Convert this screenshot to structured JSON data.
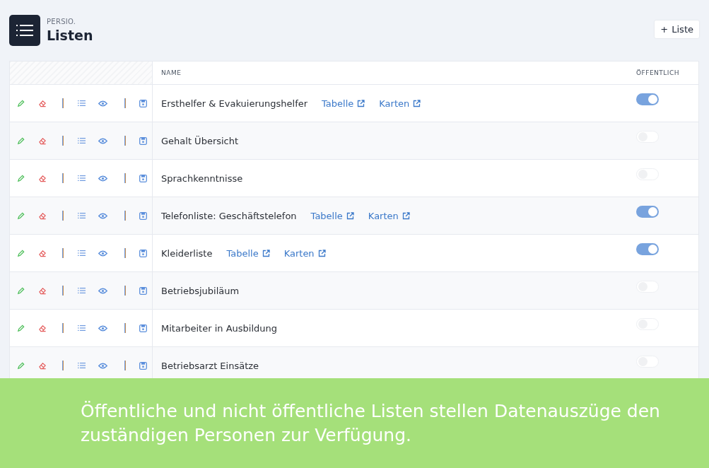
{
  "header": {
    "brand": "PERSIO.",
    "title": "Listen",
    "add_button": {
      "icon": "+",
      "label": "Liste"
    }
  },
  "table": {
    "columns": [
      "NAME",
      "ÖFFENTLICH"
    ],
    "rows": [
      {
        "name": "Ersthelfer & Evakuierungshelfer",
        "links": [
          "Tabelle",
          "Karten"
        ],
        "public": true
      },
      {
        "name": "Gehalt Übersicht",
        "links": [],
        "public": false
      },
      {
        "name": "Sprachkenntnisse",
        "links": [],
        "public": false
      },
      {
        "name": "Telefonliste: Geschäftstelefon",
        "links": [
          "Tabelle",
          "Karten"
        ],
        "public": true
      },
      {
        "name": "Kleiderliste",
        "links": [
          "Tabelle",
          "Karten"
        ],
        "public": true
      },
      {
        "name": "Betriebsjubiläum",
        "links": [],
        "public": false
      },
      {
        "name": "Mitarbeiter in Ausbildung",
        "links": [],
        "public": false
      },
      {
        "name": "Betriebsarzt Einsätze",
        "links": [],
        "public": false
      }
    ]
  },
  "caption": "Öffentliche und nicht öffentliche Listen stellen Datenauszüge den zuständigen Personen zur Verfügung."
}
